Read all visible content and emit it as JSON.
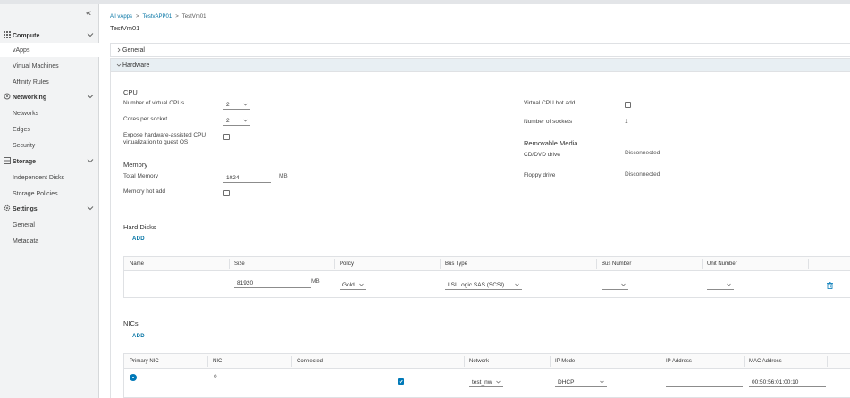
{
  "sidebar": {
    "collapse_icon": "double-chevron-left-icon",
    "sections": [
      {
        "label": "Compute",
        "icon": "grid-icon",
        "items": [
          "vApps",
          "Virtual Machines",
          "Affinity Rules"
        ]
      },
      {
        "label": "Networking",
        "icon": "network-icon",
        "items": [
          "Networks",
          "Edges",
          "Security"
        ]
      },
      {
        "label": "Storage",
        "icon": "storage-icon",
        "items": [
          "Independent Disks",
          "Storage Policies"
        ]
      },
      {
        "label": "Settings",
        "icon": "gear-icon",
        "items": [
          "General",
          "Metadata"
        ]
      }
    ],
    "active_item": "vApps"
  },
  "breadcrumb": {
    "items": [
      "All vApps",
      "TestvAPP01",
      "TestVm01"
    ],
    "separator": ">"
  },
  "page_title": "TestVm01",
  "accordions": {
    "general": "General",
    "hardware": "Hardware"
  },
  "cpu": {
    "heading": "CPU",
    "num_vcpus_label": "Number of virtual CPUs",
    "num_vcpus_value": "2",
    "cores_label": "Cores per socket",
    "cores_value": "2",
    "expose_label": "Expose hardware-assisted CPU virtualization to guest OS",
    "hot_add_label": "Virtual CPU hot add",
    "sockets_label": "Number of sockets",
    "sockets_value": "1"
  },
  "memory": {
    "heading": "Memory",
    "total_label": "Total Memory",
    "total_value": "1024",
    "unit": "MB",
    "hot_add_label": "Memory hot add"
  },
  "removable": {
    "heading": "Removable Media",
    "cd_label": "CD/DVD drive",
    "cd_value": "Disconnected",
    "floppy_label": "Floppy drive",
    "floppy_value": "Disconnected"
  },
  "hard_disks": {
    "heading": "Hard Disks",
    "add_label": "ADD",
    "columns": [
      "Name",
      "Size",
      "Policy",
      "Bus Type",
      "Bus Number",
      "Unit Number"
    ],
    "row": {
      "name": "",
      "size": "81920",
      "size_unit": "MB",
      "policy": "Gold",
      "bus_type": "LSI Logic SAS (SCSI)",
      "bus_number": "",
      "unit_number": ""
    }
  },
  "nics": {
    "heading": "NICs",
    "add_label": "ADD",
    "columns": [
      "Primary NIC",
      "NIC",
      "Connected",
      "Network",
      "IP Mode",
      "IP Address",
      "MAC Address"
    ],
    "row": {
      "nic": "0",
      "network": "test_nw",
      "ip_mode": "DHCP",
      "ip_address": "",
      "mac": "00:50:56:01:00:10"
    }
  },
  "colors": {
    "accent": "#0079b8",
    "link": "#0072a3",
    "sidebar_bg": "#f2f3f4",
    "header_bg": "#e8eff3"
  }
}
